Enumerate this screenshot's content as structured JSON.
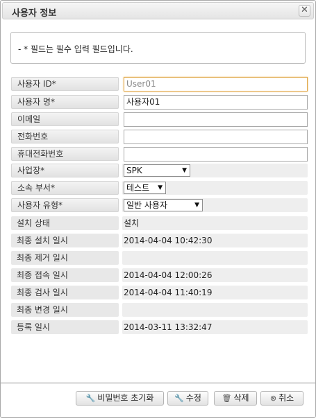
{
  "dialog": {
    "title": "사용자 정보",
    "close_icon": "close-icon"
  },
  "notice": "- * 필드는 필수 입력 필드입니다.",
  "fields": {
    "user_id": {
      "label": "사용자 ID*",
      "value": "User01"
    },
    "user_name": {
      "label": "사용자 명*",
      "value": "사용자01"
    },
    "email": {
      "label": "이메일",
      "value": ""
    },
    "phone": {
      "label": "전화번호",
      "value": ""
    },
    "mobile": {
      "label": "휴대전화번호",
      "value": ""
    },
    "site": {
      "label": "사업장*",
      "value": "SPK"
    },
    "department": {
      "label": "소속 부서*",
      "value": "테스트"
    },
    "user_type": {
      "label": "사용자 유형*",
      "value": "일반 사용자"
    },
    "install_status": {
      "label": "설치 상태",
      "value": "설치"
    },
    "last_install": {
      "label": "최종 설치 일시",
      "value": "2014-04-04 10:42:30"
    },
    "last_removal": {
      "label": "최종 제거 일시",
      "value": ""
    },
    "last_access": {
      "label": "최종 접속 일시",
      "value": "2014-04-04 12:00:26"
    },
    "last_scan": {
      "label": "최종 검사 일시",
      "value": "2014-04-04 11:40:19"
    },
    "last_change": {
      "label": "최종 변경 일시",
      "value": ""
    },
    "registered": {
      "label": "등록 일시",
      "value": "2014-03-11 13:32:47"
    }
  },
  "buttons": {
    "reset_password": "비밀번호 초기화",
    "edit": "수정",
    "delete": "삭제",
    "cancel": "취소"
  }
}
